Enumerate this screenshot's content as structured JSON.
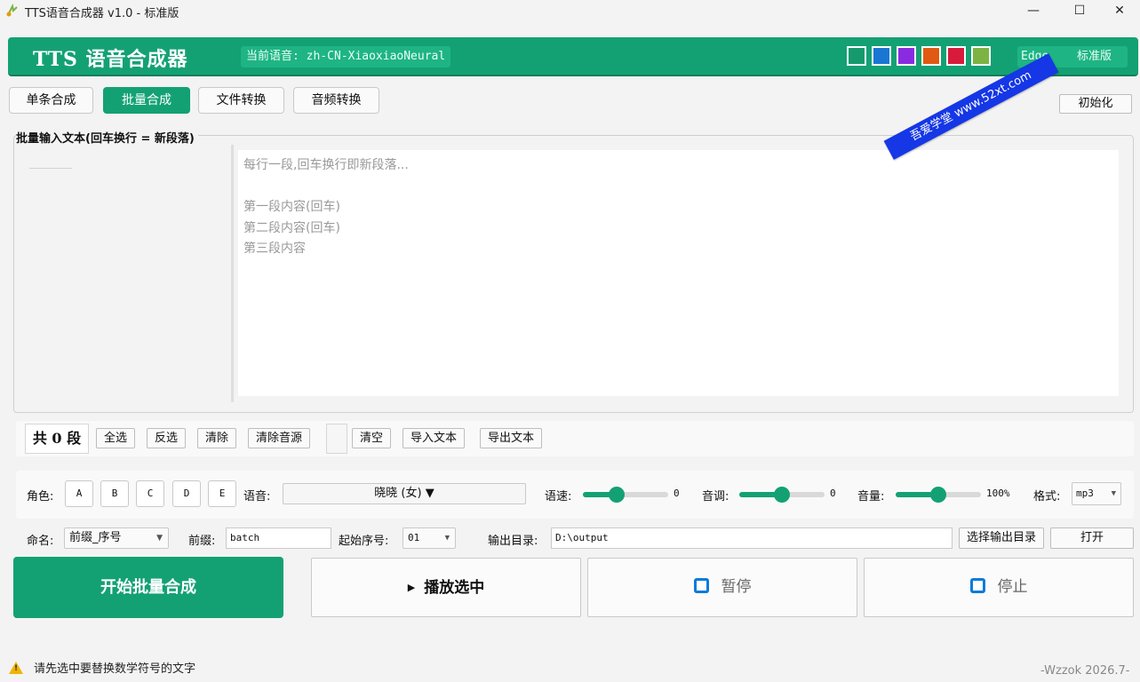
{
  "window": {
    "title": "TTS语音合成器 v1.0 - 标准版",
    "min": "—",
    "max": "☐",
    "close": "✕"
  },
  "banner": {
    "brand": "TTS 语音合成器",
    "current_voice": "当前语音: zh-CN-XiaoxiaoNeural",
    "swatches": [
      "#149a6c",
      "#1976d2",
      "#8a2be2",
      "#e05a12",
      "#d81b3c",
      "#7cb342"
    ],
    "edition_en": "Edge",
    "edition_cn": "标准版"
  },
  "watermark": "吾爱学堂 www.52xt.com",
  "tabs": {
    "single": "单条合成",
    "batch": "批量合成",
    "file": "文件转换",
    "audio": "音频转换"
  },
  "init_button": "初始化",
  "batch": {
    "section_label": "批量输入文本(回车换行 = 新段落)",
    "placeholder": "每行一段,回车换行即新段落...\n\n第一段内容(回车)\n第二段内容(回车)\n第三段内容"
  },
  "toolbar": {
    "count": "共 0 段",
    "select_all": "全选",
    "invert": "反选",
    "clear": "清除",
    "clear_audio": "清除音源",
    "empty": "清空",
    "import_text": "导入文本",
    "export_text": "导出文本"
  },
  "settings": {
    "role_label": "角色:",
    "roles": [
      "A",
      "B",
      "C",
      "D",
      "E"
    ],
    "voice_label": "语音:",
    "voice_value": "晓晓 (女) ▼",
    "rate_label": "语速:",
    "rate_value": "0",
    "rate_level": 0.4,
    "pitch_label": "音调:",
    "pitch_value": "0",
    "pitch_level": 0.5,
    "volume_label": "音量:",
    "volume_value": "100%",
    "volume_level": 0.5,
    "format_label": "格式:",
    "format_value": "mp3"
  },
  "naming": {
    "name_label": "命名:",
    "name_value": "前缀_序号",
    "prefix_label": "前缀:",
    "prefix_value": "batch",
    "start_label": "起始序号:",
    "start_value": "01",
    "output_label": "输出目录:",
    "output_value": "D:\\output",
    "choose_output": "选择输出目录",
    "open": "打开"
  },
  "actions": {
    "start_batch": "开始批量合成",
    "play_selected": "播放选中",
    "pause": "暂停",
    "stop": "停止"
  },
  "status": {
    "message": "请先选中要替换数学符号的文字",
    "signature": "-Wzzok 2026.7-"
  }
}
